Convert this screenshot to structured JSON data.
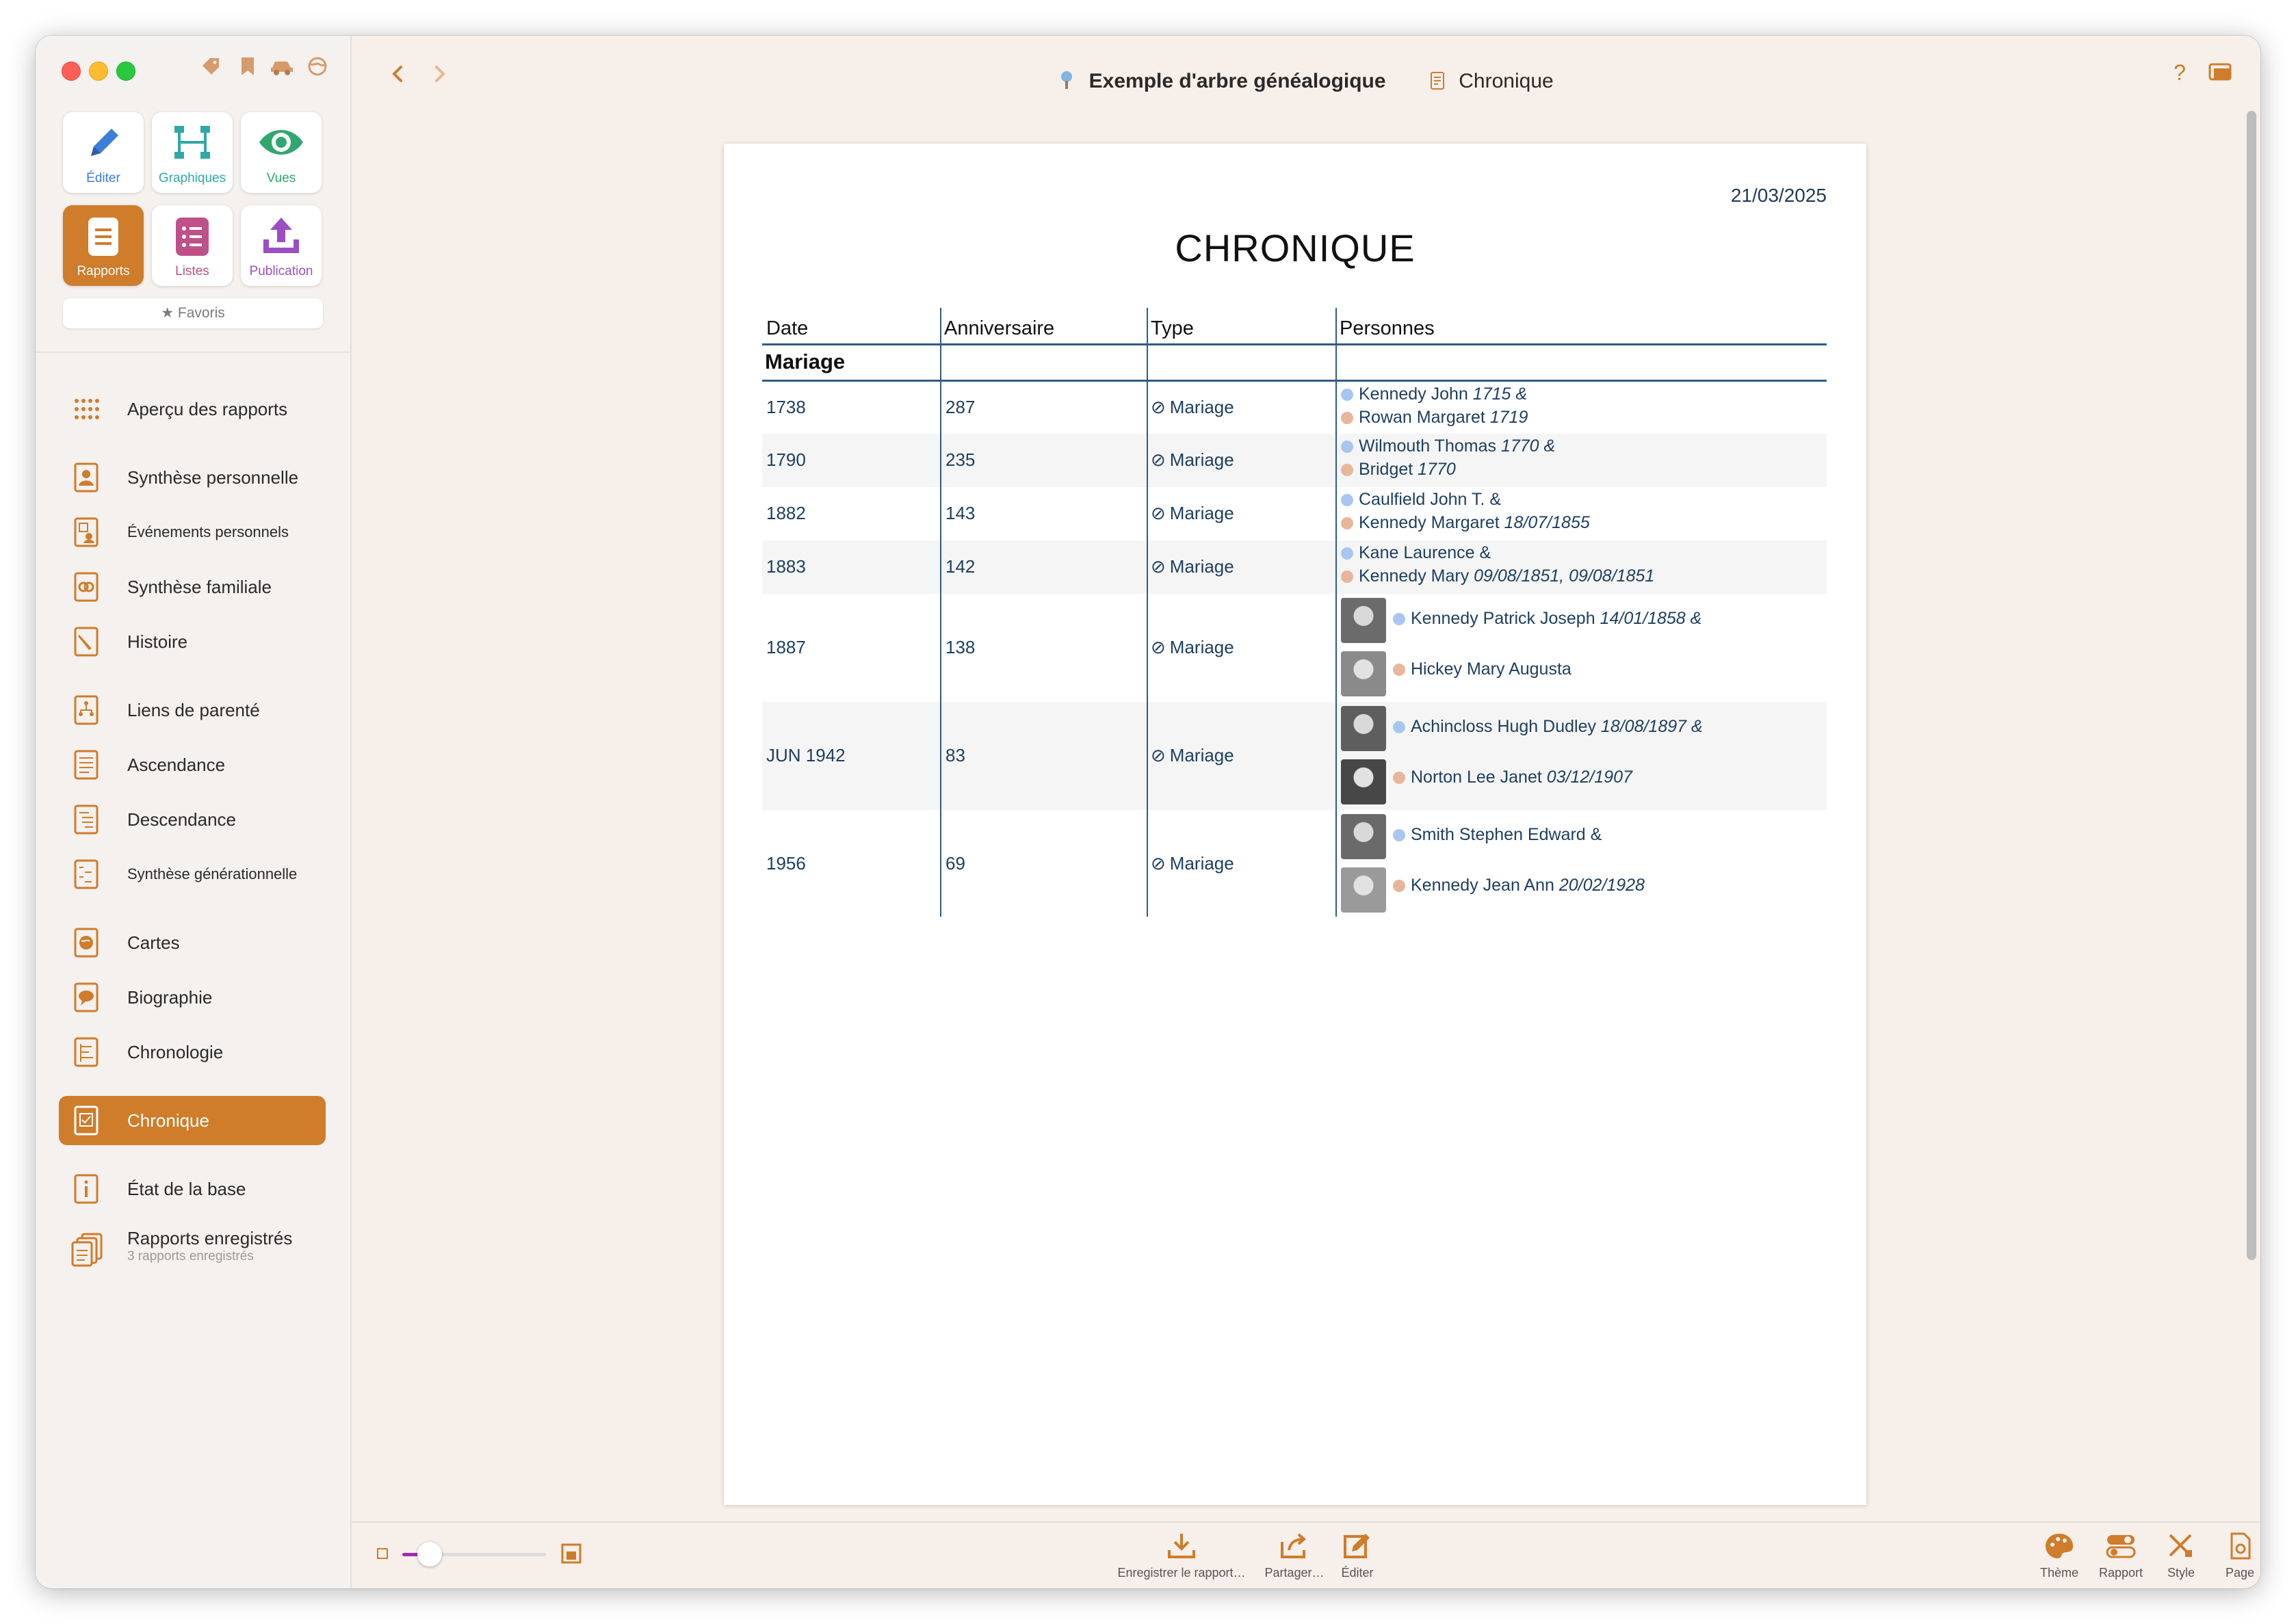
{
  "window": {
    "title": "Exemple d'arbre généalogique",
    "subtitle": "Chronique"
  },
  "top_icons": [
    "tag-icon",
    "bookmark-icon",
    "car-icon",
    "globe-icon"
  ],
  "tiles": [
    {
      "label": "Éditer",
      "icon": "pencil-icon",
      "color": "#3d7ed8"
    },
    {
      "label": "Graphiques",
      "icon": "tree-chart-icon",
      "color": "#2fa8a8"
    },
    {
      "label": "Vues",
      "icon": "eye-icon",
      "color": "#2fa870"
    },
    {
      "label": "Rapports",
      "icon": "report-icon",
      "color": "#ffffff"
    },
    {
      "label": "Listes",
      "icon": "list-icon",
      "color": "#c0508a"
    },
    {
      "label": "Publication",
      "icon": "upload-icon",
      "color": "#9b4fc4"
    }
  ],
  "favoris_label": "★ Favoris",
  "nav": [
    {
      "label": "Aperçu des rapports",
      "icon": "grid-icon"
    },
    {
      "label": "Synthèse personnelle",
      "icon": "person-card-icon"
    },
    {
      "label": "Événements personnels",
      "icon": "person-events-icon"
    },
    {
      "label": "Synthèse familiale",
      "icon": "family-rings-icon"
    },
    {
      "label": "Histoire",
      "icon": "quill-icon"
    },
    {
      "label": "Liens de parenté",
      "icon": "kinship-icon"
    },
    {
      "label": "Ascendance",
      "icon": "ascendance-icon"
    },
    {
      "label": "Descendance",
      "icon": "descendance-icon"
    },
    {
      "label": "Synthèse générationnelle",
      "icon": "generation-icon"
    },
    {
      "label": "Cartes",
      "icon": "map-globe-icon"
    },
    {
      "label": "Biographie",
      "icon": "speech-bubble-icon"
    },
    {
      "label": "Chronologie",
      "icon": "timeline-icon"
    },
    {
      "label": "Chronique",
      "icon": "chronicle-icon"
    },
    {
      "label": "État de la base",
      "icon": "info-icon"
    },
    {
      "label": "Rapports enregistrés",
      "icon": "stack-icon",
      "sub": "3 rapports enregistrés"
    }
  ],
  "report": {
    "date": "21/03/2025",
    "title": "CHRONIQUE",
    "headers": {
      "date": "Date",
      "anniv": "Anniversaire",
      "type": "Type",
      "persons": "Personnes"
    },
    "section": "Mariage",
    "rows": [
      {
        "date": "1738",
        "anniv": "287",
        "type": "Mariage",
        "p1": "Kennedy John ",
        "p1d": "1715 &",
        "p2": "Rowan Margaret ",
        "p2d": "1719"
      },
      {
        "date": "1790",
        "anniv": "235",
        "type": "Mariage",
        "p1": "Wilmouth Thomas ",
        "p1d": "1770 &",
        "p2": "Bridget ",
        "p2d": "1770"
      },
      {
        "date": "1882",
        "anniv": "143",
        "type": "Mariage",
        "p1": "Caulfield John T. &",
        "p1d": "",
        "p2": "Kennedy Margaret ",
        "p2d": "18/07/1855"
      },
      {
        "date": "1883",
        "anniv": "142",
        "type": "Mariage",
        "p1": "Kane Laurence &",
        "p1d": "",
        "p2": "Kennedy Mary ",
        "p2d": "09/08/1851, 09/08/1851"
      },
      {
        "date": "1887",
        "anniv": "138",
        "type": "Mariage",
        "p1": "Kennedy Patrick Joseph ",
        "p1d": "14/01/1858 &",
        "p2": "Hickey Mary Augusta",
        "p2d": ""
      },
      {
        "date": "JUN 1942",
        "anniv": "83",
        "type": "Mariage",
        "p1": "Achincloss Hugh Dudley ",
        "p1d": "18/08/1897 &",
        "p2": "Norton Lee Janet ",
        "p2d": "03/12/1907"
      },
      {
        "date": "1956",
        "anniv": "69",
        "type": "Mariage",
        "p1": "Smith Stephen Edward &",
        "p1d": "",
        "p2": "Kennedy Jean Ann ",
        "p2d": "20/02/1928"
      }
    ]
  },
  "bottom": {
    "save": "Enregistrer le rapport…",
    "share": "Partager…",
    "edit": "Éditer",
    "theme": "Thème",
    "rapport": "Rapport",
    "style": "Style",
    "page": "Page"
  },
  "accent": "#cf7c2b",
  "zoom_level": 0.15
}
